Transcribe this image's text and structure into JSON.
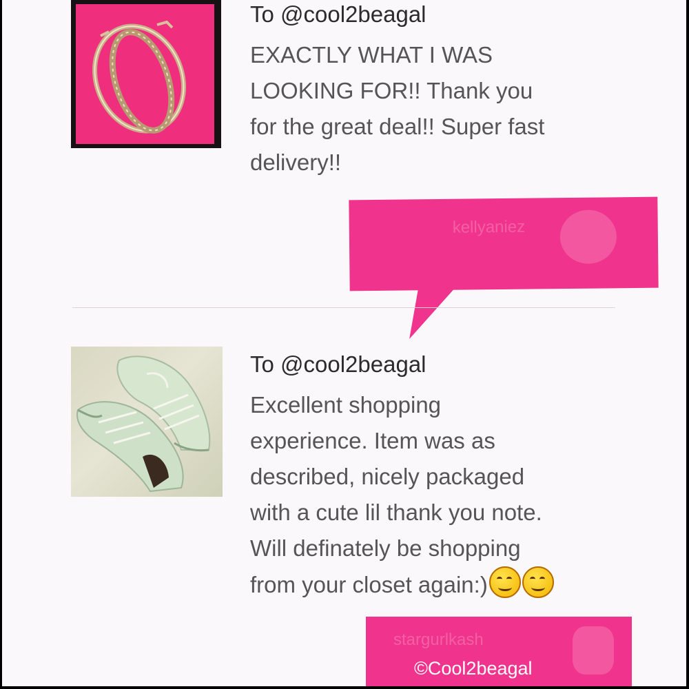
{
  "reviews": [
    {
      "to": "To @cool2beagal",
      "lines": [
        "EXACTLY WHAT I WAS",
        "LOOKING FOR!! Thank you",
        "for the great deal!! Super fast",
        "delivery!!"
      ],
      "thumbnail_icon": "hoop-earrings-photo",
      "badge_text": "kellyaniez"
    },
    {
      "to": "To @cool2beagal",
      "lines": [
        "Excellent shopping",
        "experience. Item was as",
        "described, nicely packaged",
        "with a cute lil thank you note.",
        "Will definately be shopping",
        "from your closet again:)"
      ],
      "thumbnail_icon": "sneakers-photo",
      "badge_text": "stargurlkash"
    }
  ],
  "watermark": "©Cool2beagal",
  "colors": {
    "accent_pink": "#f0338c",
    "background": "#fbf8fb",
    "text_primary": "#2b2b2b",
    "text_body": "#555555"
  }
}
